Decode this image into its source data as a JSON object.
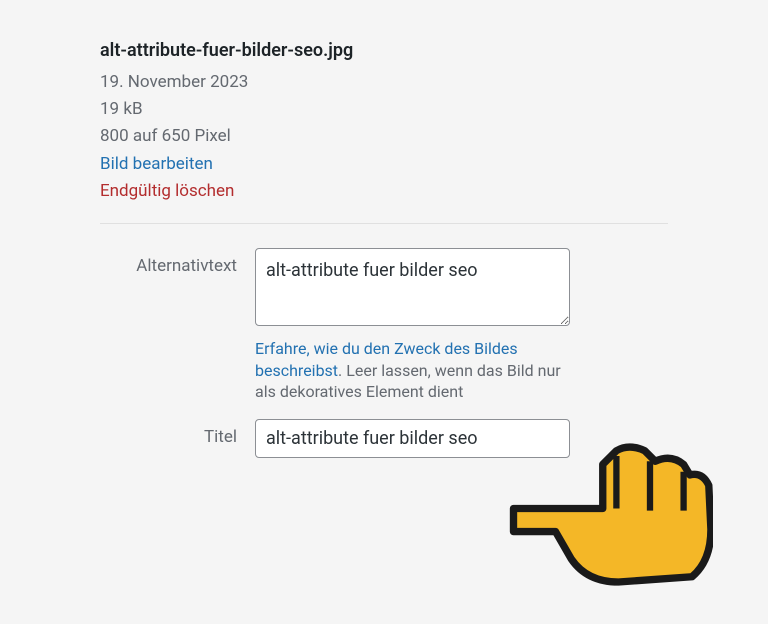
{
  "file": {
    "filename": "alt-attribute-fuer-bilder-seo.jpg",
    "date": "19. November 2023",
    "size": "19 kB",
    "dimensions": "800 auf 650 Pixel",
    "edit_label": "Bild bearbeiten",
    "delete_label": "Endgültig löschen"
  },
  "form": {
    "alt_label": "Alternativtext",
    "alt_value": "alt-attribute fuer bilder seo",
    "help_link": "Erfahre, wie du den Zweck des Bildes beschreibst",
    "help_rest": ". Leer lassen, wenn das Bild nur als dekoratives Element dient",
    "title_label": "Titel",
    "title_value": "alt-attribute fuer bilder seo"
  }
}
